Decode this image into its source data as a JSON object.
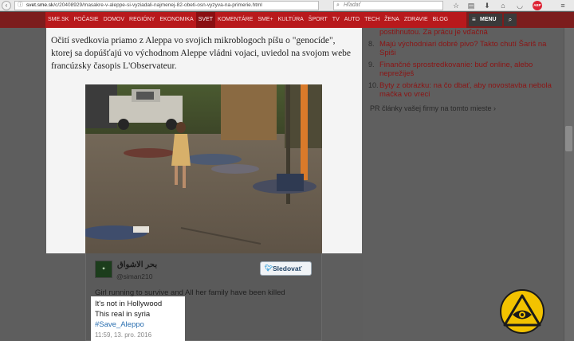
{
  "browser": {
    "url_host": "svet.sme.sk",
    "url_path": "/c/20408929/masakre-v-aleppe-si-vyziadali-najmenej-82-obeti-osn-vyzyva-na-primerie.html",
    "search_placeholder": "Hľadať"
  },
  "nav": {
    "items": [
      {
        "label": "SME.SK"
      },
      {
        "label": "POČASIE"
      },
      {
        "label": "DOMOV"
      },
      {
        "label": "REGIÓNY"
      },
      {
        "label": "EKONOMIKA"
      },
      {
        "label": "SVET",
        "active": true
      },
      {
        "label": "KOMENTÁRE"
      },
      {
        "label": "SME+"
      },
      {
        "label": "KULTÚRA"
      },
      {
        "label": "ŠPORT"
      },
      {
        "label": "TV"
      },
      {
        "label": "AUTO"
      },
      {
        "label": "TECH"
      },
      {
        "label": "ŽENA"
      },
      {
        "label": "ZDRAVIE"
      },
      {
        "label": "BLOG"
      }
    ],
    "menu_label": "MENU"
  },
  "article": {
    "paragraph": "Očití svedkovia priamo z Aleppa vo svojich mikroblogoch píšu o \"genocíde\", ktorej sa dopúšťajú vo východnom Aleppe vládni vojaci, uviedol na svojom webe francúzsky časopis L'Observateur."
  },
  "sidebar": {
    "items": [
      {
        "num": "",
        "text": "postihnutou. Za prácu je vďačná"
      },
      {
        "num": "8.",
        "text": "Majú východniari dobré pivo? Takto chutí Šariš na Spiši"
      },
      {
        "num": "9.",
        "text": "Finančné sprostredkovanie: buď online, alebo neprežiješ"
      },
      {
        "num": "10.",
        "text": "Byty z obrázku: na čo dbať, aby novostavba nebola mačka vo vreci"
      }
    ],
    "pr_link": "PR články vašej firmy na tomto mieste ›"
  },
  "tweet": {
    "name": "بحر الاشواق",
    "handle": "@siman210",
    "follow_label": "Sledovať",
    "text_line1": "Girl running to survive and All her family have been killed",
    "text_line2": "It's not in Hollywood",
    "text_line3": "This real in syria",
    "hashtag": "#Save_Aleppo",
    "timestamp": "11:59, 13. pro. 2016"
  },
  "colors": {
    "nav_red": "#b8191c",
    "nav_active": "#8a0f12",
    "link_red": "#8c1414",
    "badge_yellow": "#f2c200"
  },
  "icons": [
    "back-icon",
    "lock-icon",
    "search-icon",
    "star-icon",
    "reading-list-icon",
    "download-icon",
    "home-icon",
    "pocket-icon",
    "adblock-icon",
    "hamburger-menu-icon",
    "twitter-bird-icon",
    "eye-triangle-badge"
  ]
}
